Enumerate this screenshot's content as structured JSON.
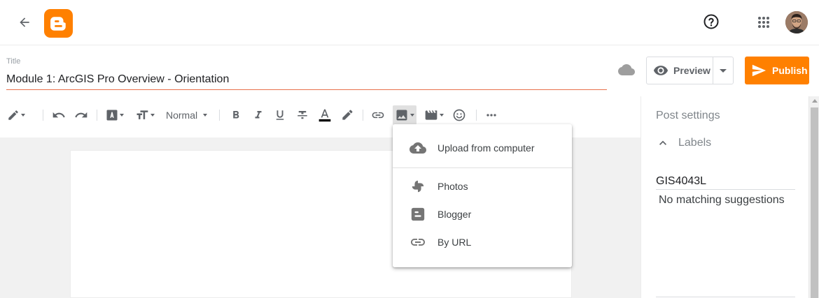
{
  "header": {
    "back_icon": "arrow-back-icon",
    "logo_icon": "blogger-logo-icon",
    "help_icon": "help-circle-icon",
    "apps_icon": "apps-grid-icon",
    "accent_color": "#ff8000"
  },
  "post": {
    "title_label": "Title",
    "title_value": "Module 1: ArcGIS Pro Overview - Orientation"
  },
  "actions": {
    "preview_label": "Preview",
    "publish_label": "Publish"
  },
  "toolbar": {
    "paragraph_style": "Normal",
    "tools": [
      "pencil",
      "undo",
      "redo",
      "font",
      "text-size",
      "bold",
      "italic",
      "underline",
      "strikethrough",
      "text-color",
      "highlight",
      "link",
      "image",
      "video",
      "emoji",
      "more"
    ]
  },
  "image_menu": {
    "items": [
      {
        "label": "Upload from computer",
        "icon": "cloud-upload-icon"
      },
      {
        "label": "Photos",
        "icon": "google-photos-icon"
      },
      {
        "label": "Blogger",
        "icon": "blogger-icon"
      },
      {
        "label": "By URL",
        "icon": "link-icon"
      }
    ]
  },
  "sidebar": {
    "title": "Post settings",
    "labels_section": "Labels",
    "label_value": "GIS4043L",
    "suggestion_text": "No matching suggestions"
  }
}
